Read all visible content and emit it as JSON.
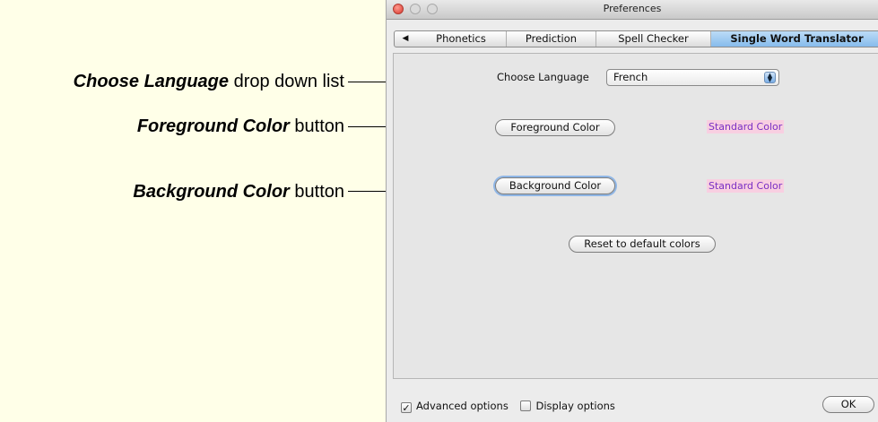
{
  "annotations": [
    {
      "bold": "Choose Language",
      "rest": " drop down list"
    },
    {
      "bold": "Foreground Color",
      "rest": " button"
    },
    {
      "bold": "Background Color",
      "rest": " button"
    }
  ],
  "window": {
    "title": "Preferences",
    "tabs": [
      "◀",
      "Phonetics",
      "Prediction",
      "Spell Checker",
      "Single Word Translator"
    ],
    "active_tab": "Single Word Translator"
  },
  "panel": {
    "choose_language_label": "Choose Language",
    "language_value": "French",
    "foreground_button": "Foreground Color",
    "background_button": "Background Color",
    "foreground_swatch": "Standard Color",
    "background_swatch": "Standard Color",
    "reset_button": "Reset to default colors"
  },
  "footer": {
    "advanced_options": "Advanced options",
    "advanced_checked": true,
    "display_options": "Display options",
    "display_checked": false,
    "ok_button": "OK"
  },
  "colors": {
    "callout_background": "#ffffe8",
    "active_tab": "#9cc8f0",
    "swatch_text": "#7a2fc4",
    "swatch_fill": "#f8cfe1"
  }
}
